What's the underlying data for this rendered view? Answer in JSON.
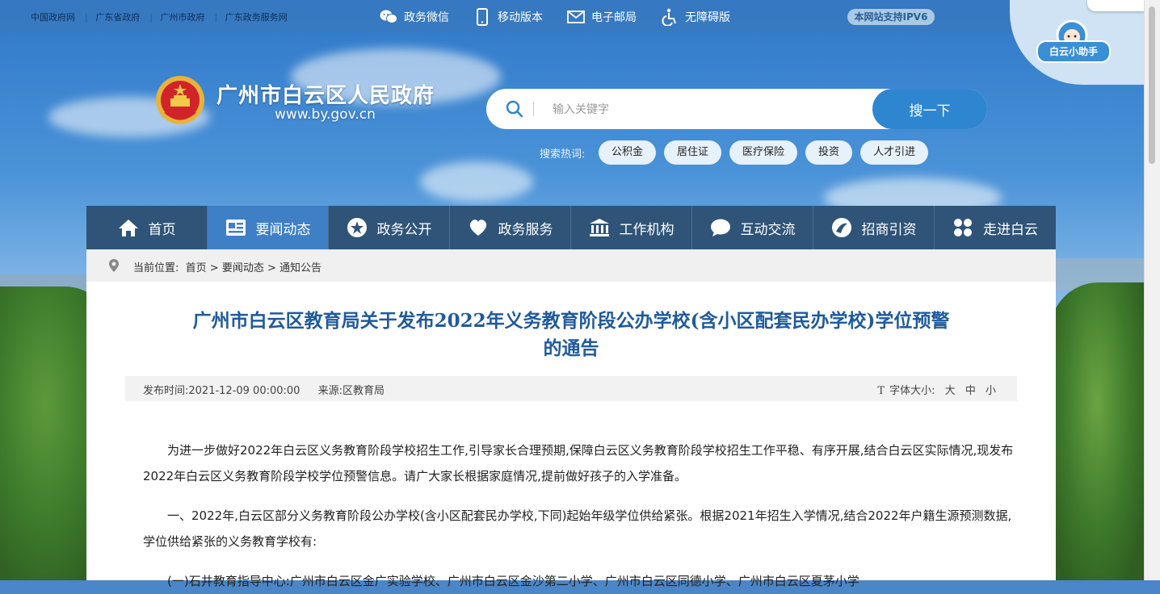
{
  "top_bar": {
    "links": [
      "中国政府网",
      "广东省政府",
      "广州市政府",
      "广东政务服务网"
    ],
    "nav": [
      {
        "label": "政务微信",
        "icon": "wechat-icon"
      },
      {
        "label": "移动版本",
        "icon": "mobile-icon"
      },
      {
        "label": "电子邮局",
        "icon": "mail-icon"
      },
      {
        "label": "无障碍版",
        "icon": "accessibility-icon"
      }
    ],
    "ipv6_badge": "本网站支持IPV6",
    "helper_label": "白云小助手"
  },
  "header": {
    "title": "广州市白云区人民政府",
    "domain": "www.by.gov.cn"
  },
  "search": {
    "placeholder": "输入关键字",
    "button_label": "搜一下",
    "hot_label": "搜索热词:",
    "hot_terms": [
      "公积金",
      "居住证",
      "医疗保险",
      "投资",
      "人才引进"
    ]
  },
  "main_nav": [
    {
      "label": "首页",
      "icon": "home-icon",
      "active": false
    },
    {
      "label": "要闻动态",
      "icon": "news-card-icon",
      "active": true
    },
    {
      "label": "政务公开",
      "icon": "star-circle-icon",
      "active": false
    },
    {
      "label": "政务服务",
      "icon": "heart-icon",
      "active": false
    },
    {
      "label": "工作机构",
      "icon": "institution-icon",
      "active": false
    },
    {
      "label": "互动交流",
      "icon": "chat-bubble-icon",
      "active": false
    },
    {
      "label": "招商引资",
      "icon": "investment-icon",
      "active": false
    },
    {
      "label": "走进白云",
      "icon": "grid-clover-icon",
      "active": false
    }
  ],
  "breadcrumb": {
    "prefix": "当前位置:",
    "path": "首页 > 要闻动态 > 通知公告"
  },
  "article": {
    "title_line1": "广州市白云区教育局关于发布2022年义务教育阶段公办学校(含小区配套民办学校)学位预警",
    "title_line2": "的通告",
    "publish_time": "发布时间:2021-12-09 00:00:00",
    "source": "来源:区教育局",
    "font_size_label": "字体大小:",
    "font_sizes": [
      "大",
      "中",
      "小"
    ],
    "paragraphs": [
      "为进一步做好2022年白云区义务教育阶段学校招生工作,引导家长合理预期,保障白云区义务教育阶段学校招生工作平稳、有序开展,结合白云区实际情况,现发布2022年白云区义务教育阶段学校学位预警信息。请广大家长根据家庭情况,提前做好孩子的入学准备。",
      "一、2022年,白云区部分义务教育阶段公办学校(含小区配套民办学校,下同)起始年级学位供给紧张。根据2021年招生入学情况,结合2022年户籍生源预测数据,学位供给紧张的义务教育学校有:",
      "(一)石井教育指导中心:广州市白云区金广实验学校、广州市白云区金沙第二小学、广州市白云区同德小学、广州市白云区夏茅小学"
    ]
  }
}
